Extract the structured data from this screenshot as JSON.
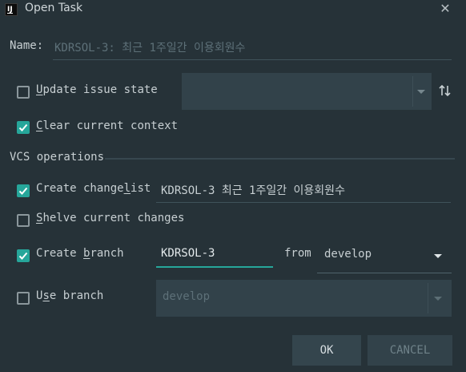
{
  "window": {
    "title": "Open Task",
    "app_icon_text": "IJ"
  },
  "name_field": {
    "label": "Name:",
    "value": "KDRSOL-3: 최근 1주일간 이용회원수"
  },
  "update_issue_state": {
    "label_prefix": "",
    "label_mnemonic": "U",
    "label_rest": "pdate issue state",
    "checked": false,
    "combo_value": ""
  },
  "clear_context": {
    "label_mnemonic": "C",
    "label_rest": "lear current context",
    "checked": true
  },
  "vcs_section": {
    "title": "VCS operations"
  },
  "create_changelist": {
    "label_prefix": "Create change",
    "label_mnemonic": "l",
    "label_rest": "ist",
    "checked": true,
    "value": "KDRSOL-3 최근 1주일간 이용회원수"
  },
  "shelve_changes": {
    "label_prefix": "",
    "label_mnemonic": "S",
    "label_rest": "helve current changes",
    "checked": false
  },
  "create_branch": {
    "label_prefix": "Create ",
    "label_mnemonic": "b",
    "label_rest": "ranch",
    "checked": true,
    "value": "KDRSOL-3",
    "from_label": "from",
    "from_value": "develop"
  },
  "use_branch": {
    "label_prefix": "U",
    "label_mnemonic": "s",
    "label_rest": "e branch",
    "checked": false,
    "value": "develop"
  },
  "buttons": {
    "ok": "OK",
    "cancel": "CANCEL"
  },
  "colors": {
    "background": "#263238",
    "accent": "#26a69a",
    "text": "#c7cfd2"
  }
}
